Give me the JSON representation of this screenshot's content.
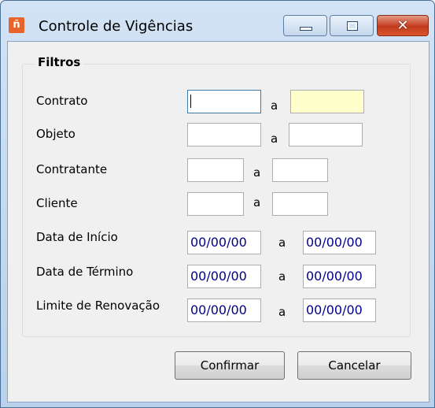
{
  "window": {
    "title": "Controle de Vigências",
    "icon": "app-icon",
    "controls": {
      "minimize": "minimize-icon",
      "maximize": "maximize-icon",
      "close": "close-icon"
    }
  },
  "filters": {
    "legend": "Filtros",
    "range_separator": "a",
    "rows": [
      {
        "label": "Contrato",
        "from": "",
        "to": ""
      },
      {
        "label": "Objeto",
        "from": "",
        "to": ""
      },
      {
        "label": "Contratante",
        "from": "",
        "to": ""
      },
      {
        "label": "Cliente",
        "from": "",
        "to": ""
      },
      {
        "label": "Data de Início",
        "from": "00/00/00",
        "to": "00/00/00"
      },
      {
        "label": "Data de Término",
        "from": "00/00/00",
        "to": "00/00/00"
      },
      {
        "label": "Limite de Renovação",
        "from": "00/00/00",
        "to": "00/00/00"
      }
    ]
  },
  "buttons": {
    "confirm": "Confirmar",
    "cancel": "Cancelar"
  },
  "colors": {
    "required_field_bg": "#ffffcc",
    "date_text": "#00008b",
    "close_button": "#c33a1c"
  }
}
